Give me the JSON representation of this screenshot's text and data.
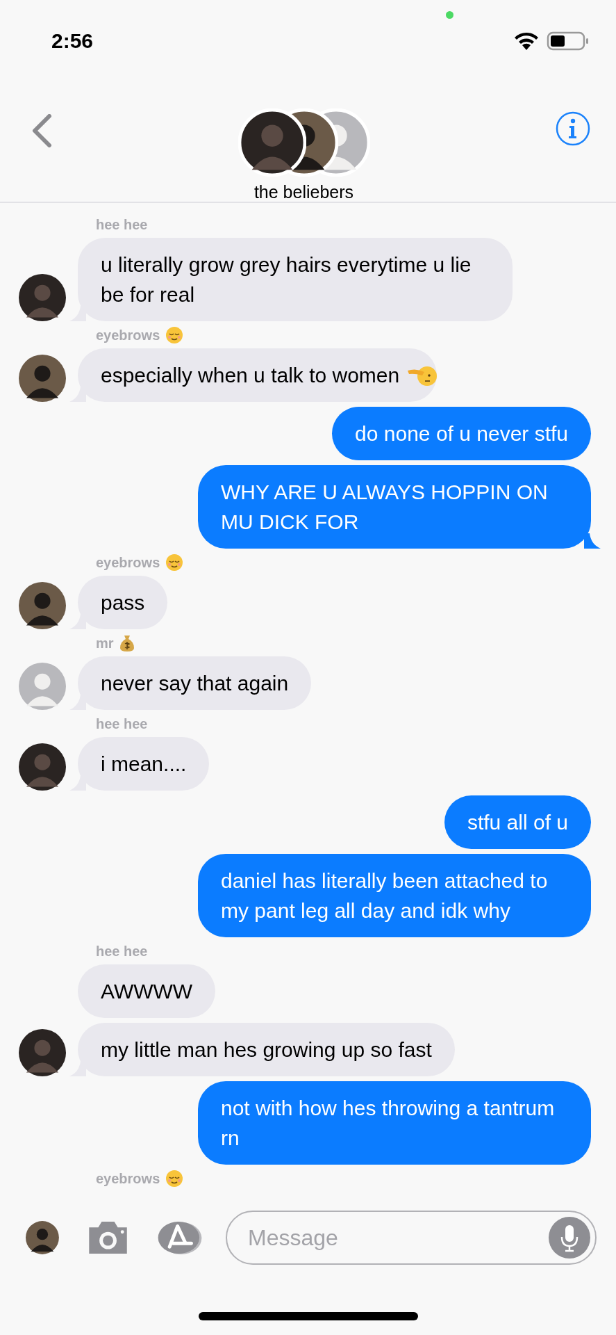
{
  "status_bar": {
    "time": "2:56"
  },
  "header": {
    "title": "the beliebers",
    "avatars": [
      {
        "kind": "dark"
      },
      {
        "kind": "tan"
      },
      {
        "kind": "light"
      }
    ]
  },
  "messages": [
    {
      "kind": "sender",
      "name": "hee hee"
    },
    {
      "kind": "in",
      "text": "u literally grow grey hairs everytime u lie be for real",
      "avatar": {
        "kind": "dark"
      },
      "tail": true
    },
    {
      "kind": "sender",
      "name": "eyebrows",
      "emoji": {
        "kind": "relieved"
      }
    },
    {
      "kind": "in",
      "text": "especially when u talk to women",
      "emoji": {
        "kind": "salute"
      },
      "avatar": {
        "kind": "tan"
      },
      "tail": true
    },
    {
      "kind": "out",
      "text": "do none of u never stfu",
      "tail": false
    },
    {
      "kind": "out",
      "text": "WHY ARE U ALWAYS HOPPIN ON MU DICK FOR",
      "tail": true
    },
    {
      "kind": "sender",
      "name": "eyebrows",
      "emoji": {
        "kind": "relieved"
      }
    },
    {
      "kind": "in",
      "text": "pass",
      "avatar": {
        "kind": "tan"
      },
      "tail": true
    },
    {
      "kind": "sender",
      "name": "mr",
      "emoji": {
        "kind": "money"
      }
    },
    {
      "kind": "in",
      "text": "never say that again",
      "avatar": {
        "kind": "light"
      },
      "tail": true
    },
    {
      "kind": "sender",
      "name": "hee hee"
    },
    {
      "kind": "in",
      "text": "i mean....",
      "avatar": {
        "kind": "dark"
      },
      "tail": true
    },
    {
      "kind": "out",
      "text": "stfu all of u",
      "tail": false
    },
    {
      "kind": "out",
      "text": "daniel has literally been attached to my pant leg all day and idk why",
      "tail": false
    },
    {
      "kind": "sender",
      "name": "hee hee"
    },
    {
      "kind": "in",
      "text": "AWWWW",
      "tail": false
    },
    {
      "kind": "in",
      "text": "my little man hes growing up so fast",
      "avatar": {
        "kind": "dark"
      },
      "tail": true
    },
    {
      "kind": "out",
      "text": "not with how hes throwing a tantrum rn",
      "tail": false
    },
    {
      "kind": "sender",
      "name": "eyebrows",
      "emoji": {
        "kind": "relieved"
      }
    }
  ],
  "composer": {
    "avatar": {
      "kind": "tan"
    },
    "placeholder": "Message"
  }
}
